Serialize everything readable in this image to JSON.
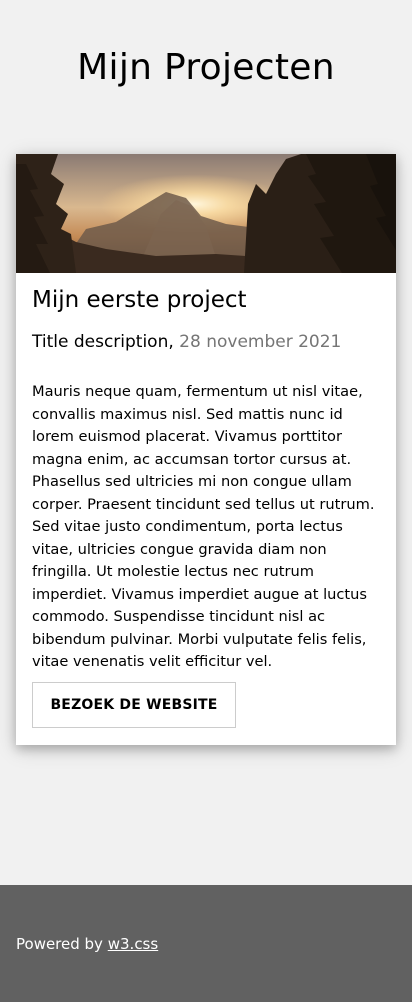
{
  "header": {
    "title": "Mijn Projecten"
  },
  "project": {
    "image_alt": "mountain landscape at sunset",
    "title": "Mijn eerste project",
    "subtitle": "Title description,",
    "date": "28 november 2021",
    "description": "Mauris neque quam, fermentum ut nisl vitae, convallis maximus nisl. Sed mattis nunc id lorem euismod placerat. Vivamus porttitor magna enim, ac accumsan tortor cursus at. Phasellus sed ultricies mi non congue ullam corper. Praesent tincidunt sed tellus ut rutrum. Sed vitae justo condimentum, porta lectus vitae, ultricies congue gravida diam non fringilla. Ut molestie lectus nec rutrum imperdiet. Vivamus imperdiet augue at luctus commodo. Suspendisse tincidunt nisl ac bibendum pulvinar. Morbi vulputate felis felis, vitae venenatis velit efficitur vel.",
    "button_label": "BEZOEK DE WEBSITE"
  },
  "footer": {
    "powered_by": "Powered by",
    "link_label": "w3.css"
  },
  "colors": {
    "page_background": "#f1f1f1",
    "card_background": "#ffffff",
    "date_text": "#757575",
    "footer_background": "#616161",
    "footer_text": "#ffffff"
  }
}
